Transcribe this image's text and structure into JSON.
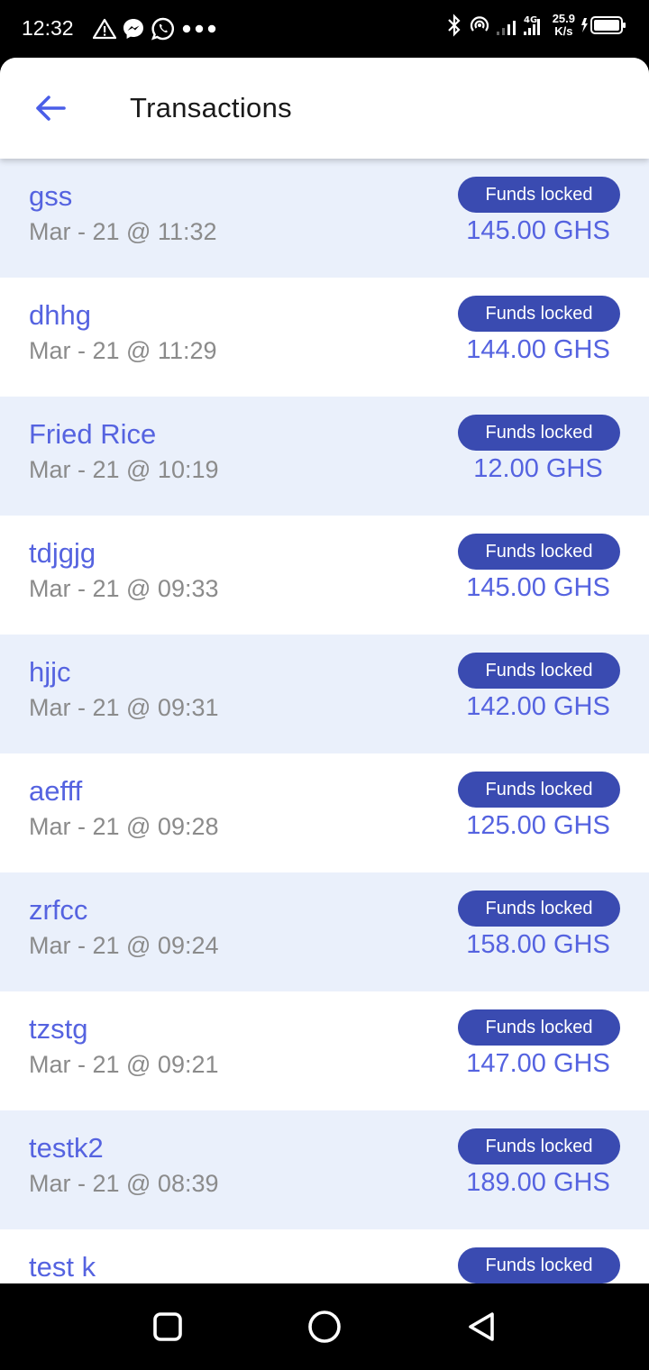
{
  "status_bar": {
    "time": "12:32",
    "network": "4G",
    "speed_value": "25.9",
    "speed_unit": "K/s",
    "icons": [
      "warning-icon",
      "messenger-icon",
      "whatsapp-icon",
      "more-dots-icon",
      "bluetooth-icon",
      "hotspot-icon",
      "signal-icon",
      "battery-icon"
    ]
  },
  "header": {
    "title": "Transactions",
    "back_icon": "arrow-left-icon"
  },
  "colors": {
    "accent": "#5563e0",
    "badge": "#3a4bb1",
    "row_alt": "#eaf0fb",
    "date_text": "#8b8b8b"
  },
  "transactions": [
    {
      "name": "gss",
      "date": "Mar - 21 @ 11:32",
      "status": "Funds locked",
      "amount": "145.00 GHS"
    },
    {
      "name": "dhhg",
      "date": "Mar - 21 @ 11:29",
      "status": "Funds locked",
      "amount": "144.00 GHS"
    },
    {
      "name": "Fried Rice",
      "date": "Mar - 21 @ 10:19",
      "status": "Funds locked",
      "amount": "12.00 GHS"
    },
    {
      "name": "tdjgjg",
      "date": "Mar - 21 @ 09:33",
      "status": "Funds locked",
      "amount": "145.00 GHS"
    },
    {
      "name": "hjjc",
      "date": "Mar - 21 @ 09:31",
      "status": "Funds locked",
      "amount": "142.00 GHS"
    },
    {
      "name": "aefff",
      "date": "Mar - 21 @ 09:28",
      "status": "Funds locked",
      "amount": "125.00 GHS"
    },
    {
      "name": "zrfcc",
      "date": "Mar - 21 @ 09:24",
      "status": "Funds locked",
      "amount": "158.00 GHS"
    },
    {
      "name": "tzstg",
      "date": "Mar - 21 @ 09:21",
      "status": "Funds locked",
      "amount": "147.00 GHS"
    },
    {
      "name": "testk2",
      "date": "Mar - 21 @ 08:39",
      "status": "Funds locked",
      "amount": "189.00 GHS"
    },
    {
      "name": "test k",
      "date": "",
      "status": "Funds locked",
      "amount": ""
    }
  ],
  "nav_bar": {
    "icons": [
      "recents-square-icon",
      "home-circle-icon",
      "back-triangle-icon"
    ]
  }
}
